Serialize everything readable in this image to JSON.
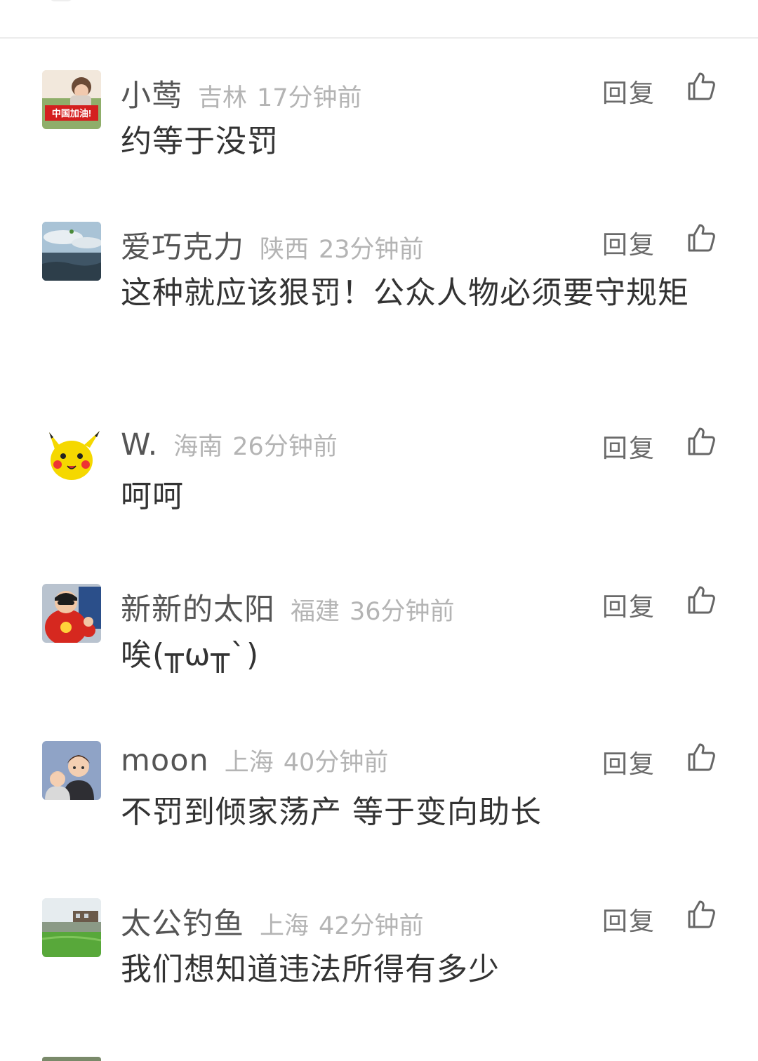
{
  "action_labels": {
    "reply": "回复"
  },
  "icons": {
    "like": "thumbs-up-icon"
  },
  "colors": {
    "username": "#555555",
    "meta": "#b4b4b4",
    "text": "#333333",
    "action": "#6a6a6a"
  },
  "comments": [
    {
      "username": "小莺",
      "location": "吉林",
      "time": "17分钟前",
      "text": "约等于没罚",
      "avatar_badge": "中国加油!"
    },
    {
      "username": "爱巧克力",
      "location": "陕西",
      "time": "23分钟前",
      "text": "这种就应该狠罚！公众人物必须要守规矩"
    },
    {
      "username": "W.",
      "location": "海南",
      "time": "26分钟前",
      "text": "呵呵"
    },
    {
      "username": "新新的太阳",
      "location": "福建",
      "time": "36分钟前",
      "text": "唉(╥ω╥`)"
    },
    {
      "username": "moon",
      "location": "上海",
      "time": "40分钟前",
      "text": "不罚到倾家荡产 等于变向助长"
    },
    {
      "username": "太公钓鱼",
      "location": "上海",
      "time": "42分钟前",
      "text": "我们想知道违法所得有多少"
    }
  ]
}
